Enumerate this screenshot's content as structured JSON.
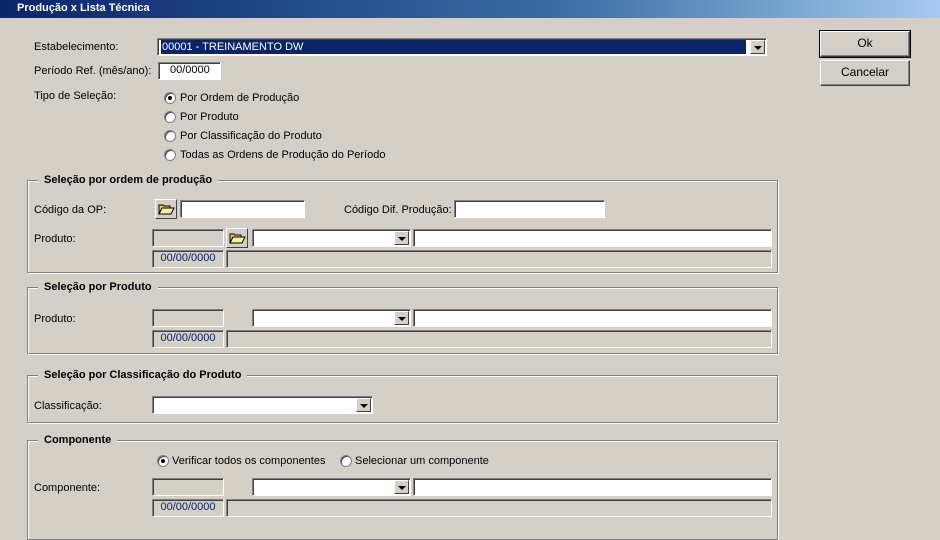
{
  "window": {
    "title": "Produção x Lista Técnica"
  },
  "buttons": {
    "ok": "Ok",
    "cancel": "Cancelar"
  },
  "header": {
    "estabelecimento_label": "Estabelecimento:",
    "estabelecimento_value": "00001 - TREINAMENTO DW",
    "periodo_label": "Período Ref. (mês/ano):",
    "periodo_value": "00/0000",
    "tipo_label": "Tipo de Seleção:",
    "tipo_options": [
      "Por Ordem de Produção",
      "Por Produto",
      "Por Classificação do Produto",
      "Todas as Ordens de Produção do Período"
    ],
    "tipo_selected": 0
  },
  "group_ordem": {
    "title": "Seleção por ordem de produção",
    "codigo_op_label": "Código da OP:",
    "codigo_dif_label": "Código Dif. Produção:",
    "produto_label": "Produto:",
    "date": "00/00/0000"
  },
  "group_produto": {
    "title": "Seleção por Produto",
    "produto_label": "Produto:",
    "date": "00/00/0000"
  },
  "group_classificacao": {
    "title": "Seleção por Classificação do Produto",
    "classificacao_label": "Classificação:"
  },
  "group_componente": {
    "title": "Componente",
    "option_all": "Verificar todos os componentes",
    "option_one": "Selecionar um componente",
    "componente_label": "Componente:",
    "date": "00/00/0000"
  },
  "icons": {
    "folder": "folder-open-icon"
  }
}
